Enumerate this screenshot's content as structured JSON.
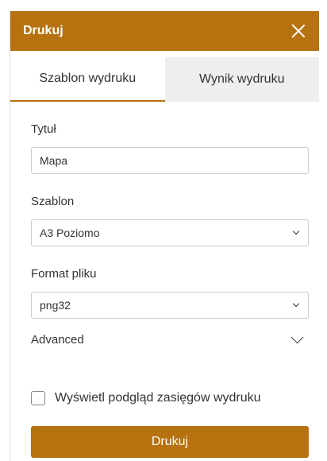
{
  "header": {
    "title": "Drukuj",
    "close_icon": "close-icon"
  },
  "tabs": [
    {
      "label": "Szablon wydruku",
      "active": true
    },
    {
      "label": "Wynik wydruku",
      "active": false
    }
  ],
  "form": {
    "title_label": "Tytuł",
    "title_value": "Mapa",
    "template_label": "Szablon",
    "template_value": "A3 Poziomo",
    "format_label": "Format pliku",
    "format_value": "png32",
    "advanced_label": "Advanced",
    "extent_checkbox_label": "Wyświetl podgląd zasięgów wydruku",
    "extent_checkbox_checked": false,
    "print_button_label": "Drukuj"
  },
  "colors": {
    "accent": "#b5720f",
    "tab_inactive": "#eeeeee"
  }
}
